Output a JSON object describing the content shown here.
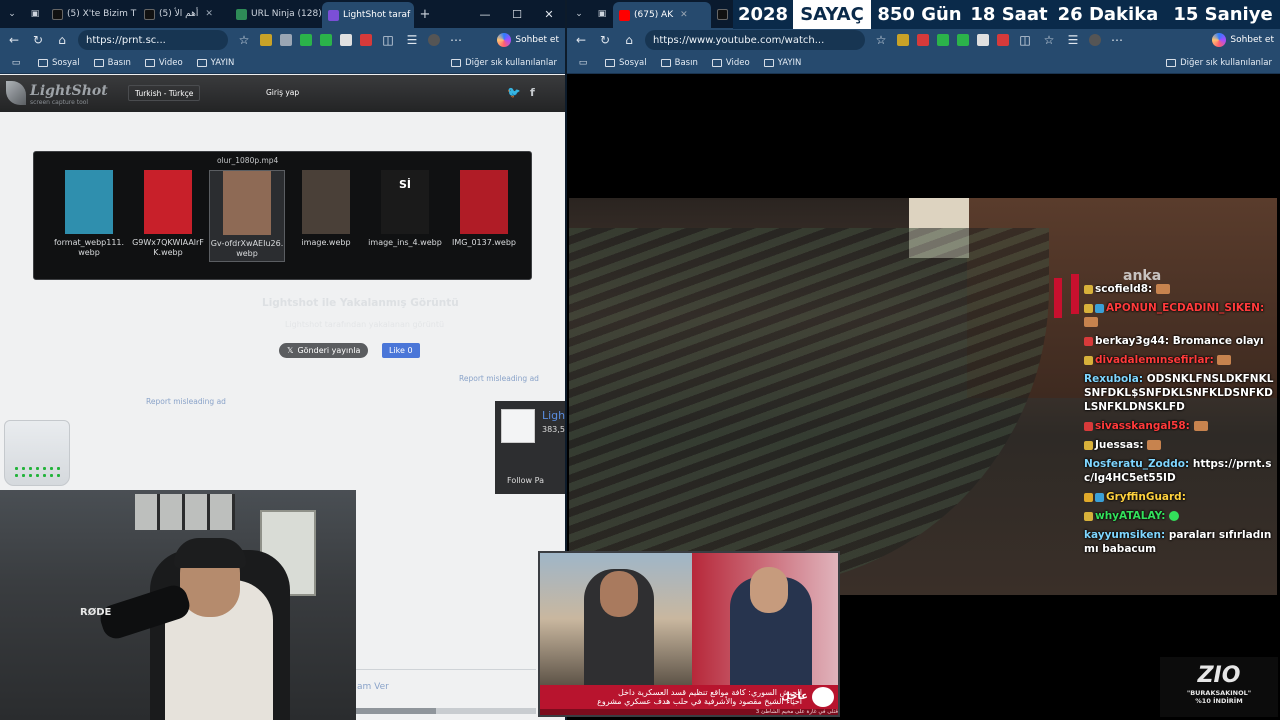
{
  "left_browser": {
    "tabs": [
      {
        "label": "(5) X'te Bizim T",
        "color": "#111111"
      },
      {
        "label": "(5) أهم الأ",
        "color": "#111111"
      },
      {
        "label": "URL Ninja (128)",
        "color": "#2e8b57"
      },
      {
        "label": "LightShot taraf",
        "color": "#7b4fd6"
      }
    ],
    "url": "https://prnt.sc...",
    "sohbet": "Sohbet et",
    "bookmarks": [
      "Sosyal",
      "Basın",
      "Video",
      "YAYIN"
    ],
    "bookmarks_right": "Diğer sık kullanılanlar"
  },
  "lightshot": {
    "logo": "LightShot",
    "logo_sub": "screen capture tool",
    "language": "Turkish - Türkçe",
    "login": "Giriş yap",
    "dialog_filename": "olur_1080p.mp4",
    "thumbnails": [
      {
        "caption": "format_webp111.webp",
        "color": "#2f8fae"
      },
      {
        "caption": "G9Wx7QKWIAAlrFK.webp",
        "color": "#c8202a"
      },
      {
        "caption": "Gv-ofdrXwAEIu26.webp",
        "color": "#8e6a55"
      },
      {
        "caption": "image.webp",
        "color": "#4a4038"
      },
      {
        "caption": "image_ins_4.webp",
        "color": "#1a1a1a"
      },
      {
        "caption": "IMG_0137.webp",
        "color": "#b01c26"
      }
    ],
    "faded_title": "Lightshot ile Yakalanmış Görüntü",
    "faded_sub": "Lightshot tarafından yakalanan görüntü",
    "tweet_button": "Gönderi yayınla",
    "like_button": "Like 0",
    "ad_link_1": "Report misleading ad",
    "ad_link_2": "Report misleading ad",
    "box_title": "Ligh",
    "box_count": "383,5",
    "box_follow": "Follow Pa",
    "footer_link": "am Ver"
  },
  "right_browser": {
    "tabs": [
      {
        "label": "(675) AK",
        "color": "#ff0000"
      }
    ],
    "url": "https://www.youtube.com/watch...",
    "sohbet": "Sohbet et",
    "bookmarks": [
      "Sosyal",
      "Basın",
      "Video",
      "YAYIN"
    ],
    "bookmarks_right": "Diğer sık kullanılanlar"
  },
  "counter": [
    {
      "text": "2028",
      "style": "dark"
    },
    {
      "text": "SAYAÇ",
      "style": "white"
    },
    {
      "text": "850 Gün",
      "style": "dark"
    },
    {
      "text": "18 Saat",
      "style": "dark"
    },
    {
      "text": "26 Dakika",
      "style": "dark"
    },
    {
      "text": "15 Saniye",
      "style": "dark"
    }
  ],
  "video_watermark": "anka",
  "chat": [
    {
      "user": "scofield8:",
      "color": "#ffffff",
      "text": ""
    },
    {
      "user": "APONUN_ECDADINI_SIKEN:",
      "color": "#ff3b3b",
      "text": ""
    },
    {
      "user": "berkay3g44:",
      "color": "#ffffff",
      "text": "Bromance olayı"
    },
    {
      "user": "divadalemınsefirlar:",
      "color": "#ff3b3b",
      "text": ""
    },
    {
      "user": "Rexubola:",
      "color": "#7fd6ff",
      "text": "ODSNKLFNSLDKFNKLSNFDKL$SNFDKLSNFKLDSNFKDLSNFKLDNSKLFD"
    },
    {
      "user": "sivasskangal58:",
      "color": "#ff3b3b",
      "text": ""
    },
    {
      "user": "Juessas:",
      "color": "#ffffff",
      "text": ""
    },
    {
      "user": "Nosferatu_Zoddo:",
      "color": "#7fd6ff",
      "text": "https://prnt.sc/lg4HC5et55ID"
    },
    {
      "user": "GryffinGuard:",
      "color": "#ffd23f",
      "text": ""
    },
    {
      "user": "whyATALAY:",
      "color": "#33e05b",
      "text": ""
    },
    {
      "user": "kayyumsiken:",
      "color": "#7fd6ff",
      "text": "paraları sıfırladın mı babacum"
    }
  ],
  "news": {
    "headline_1": "الجيش السوري: كافة مواقع تنظيم قسد العسكرية داخل",
    "headline_2": "أحياء الشيخ مقصود والأشرفية في حلب هدف عسكري مشروع",
    "label": "عاجل",
    "ticker": "3 قتلى في غارة على مخيم الشاطئ"
  },
  "sponsor": {
    "brand": "ZIO",
    "line1": "\"BURAKSAKINOL\"",
    "line2": "%10 İNDİRİM"
  },
  "colors": {
    "accent_toolbar": "#264a6e",
    "tab_bg": "#0a1a2e",
    "counter_bg": "#0a2a4a"
  }
}
